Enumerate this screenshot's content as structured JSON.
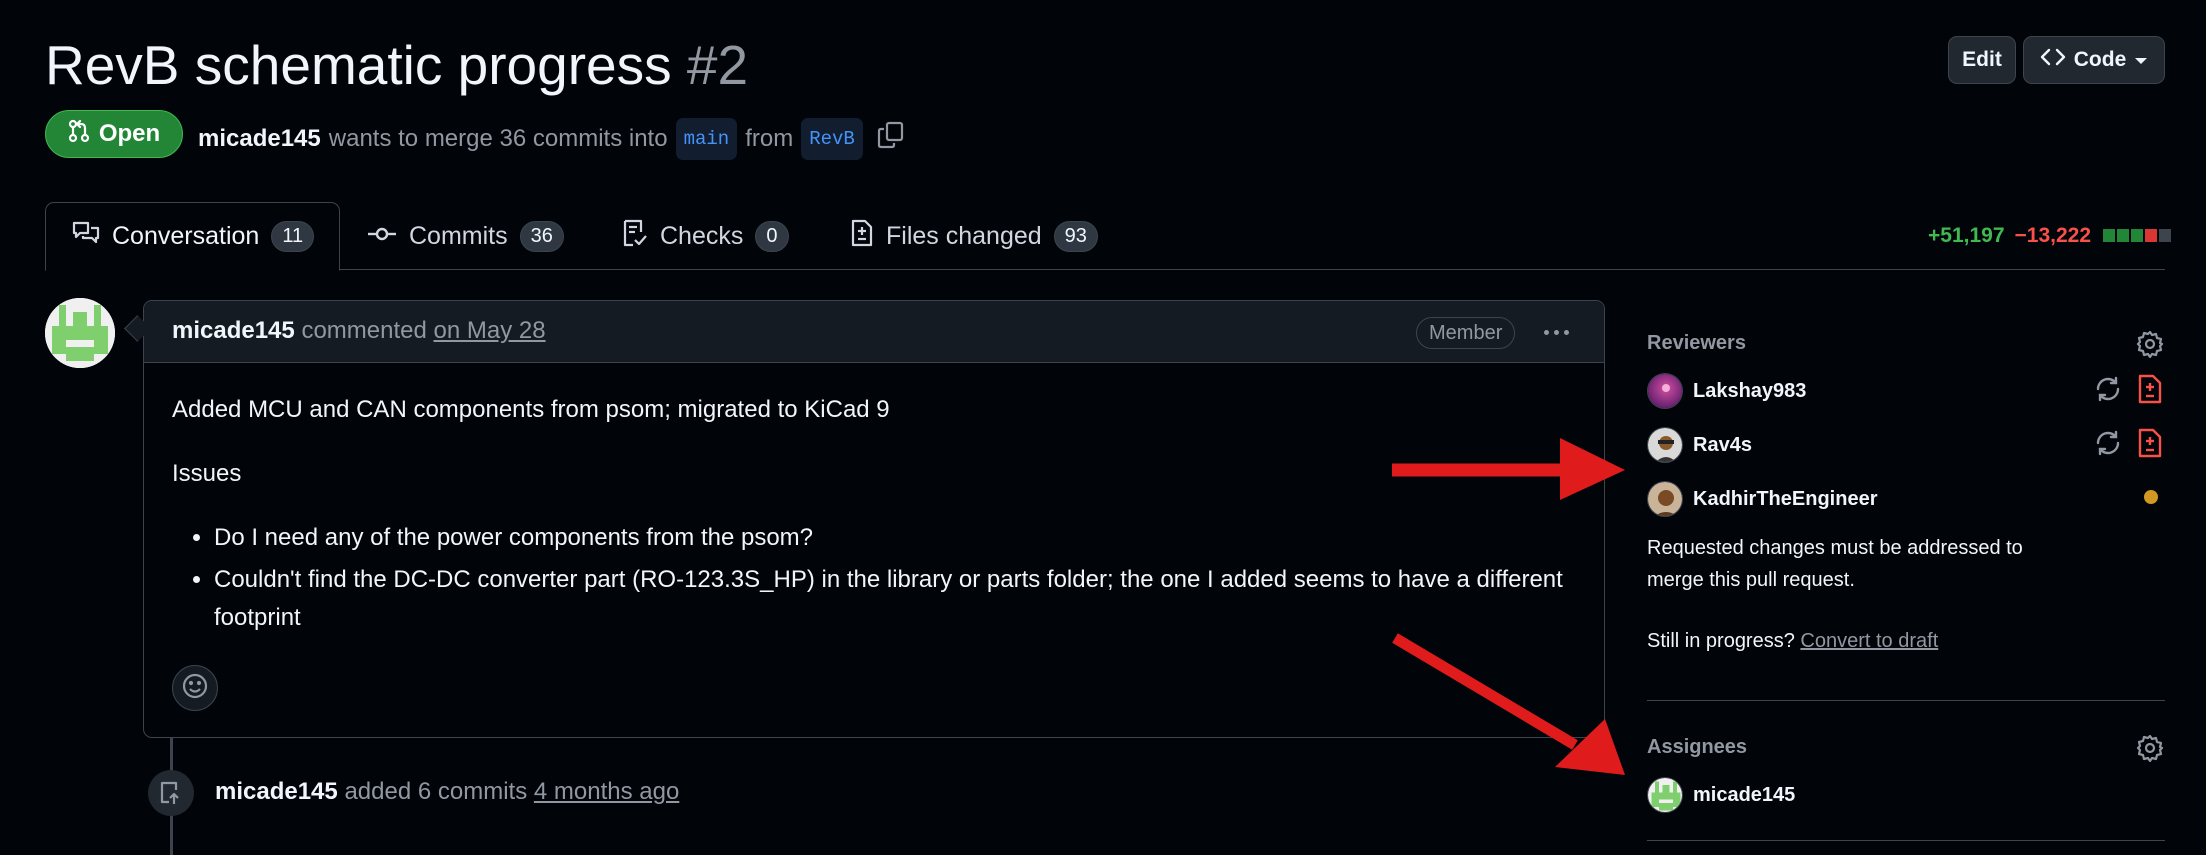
{
  "pr": {
    "title": "RevB schematic progress",
    "number": "#2",
    "status": "Open",
    "author": "micade145",
    "merge_text": "wants to merge 36 commits into",
    "base_branch": "main",
    "from_text": "from",
    "head_branch": "RevB"
  },
  "header_actions": {
    "edit_label": "Edit",
    "code_label": "Code"
  },
  "tabs": [
    {
      "label": "Conversation",
      "count": "11",
      "icon": "comment-discussion-icon"
    },
    {
      "label": "Commits",
      "count": "36",
      "icon": "git-commit-icon"
    },
    {
      "label": "Checks",
      "count": "0",
      "icon": "checklist-icon"
    },
    {
      "label": "Files changed",
      "count": "93",
      "icon": "file-diff-icon"
    }
  ],
  "diffstat": {
    "additions": "+51,197",
    "deletions": "−13,222",
    "squares": [
      "#238636",
      "#238636",
      "#238636",
      "#da3633",
      "#3d444d"
    ]
  },
  "comment": {
    "author": "micade145",
    "action": "commented",
    "date": "on May 28",
    "role_badge": "Member",
    "paragraph1": "Added MCU and CAN components from psom; migrated to KiCad 9",
    "paragraph2": "Issues",
    "bullets": [
      "Do I need any of the power components from the psom?",
      "Couldn't find the DC-DC converter part (RO-123.3S_HP) in the library or parts folder; the one I added seems to have a different footprint"
    ]
  },
  "timeline_event": {
    "author": "micade145",
    "action": "added 6 commits",
    "time": "4 months ago"
  },
  "sidebar": {
    "reviewers_heading": "Reviewers",
    "reviewers": [
      {
        "name": "Lakshay983",
        "state": "changes-requested"
      },
      {
        "name": "Rav4s",
        "state": "changes-requested"
      },
      {
        "name": "KadhirTheEngineer",
        "state": "pending"
      }
    ],
    "requested_changes_text": "Requested changes must be addressed to merge this pull request.",
    "still_in_progress": "Still in progress?",
    "convert_to_draft": "Convert to draft",
    "assignees_heading": "Assignees",
    "assignees": [
      {
        "name": "micade145"
      }
    ]
  },
  "colors": {
    "accent_green": "#238636",
    "deletion_red": "#f85149",
    "pending_yellow": "#d29922",
    "annotation_arrow": "#e01b1b"
  }
}
